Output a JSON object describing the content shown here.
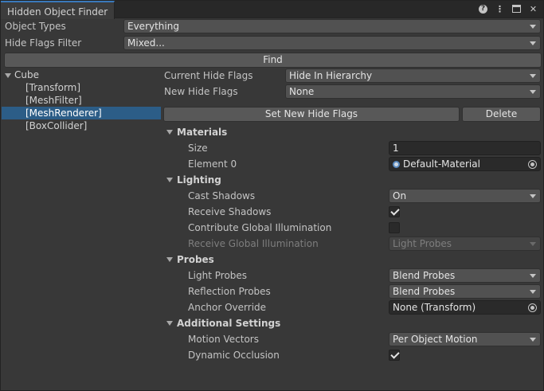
{
  "window": {
    "tab_title": "Hidden Object Finder"
  },
  "titlebar_icons": [
    "help-icon",
    "kebab-menu-icon",
    "maximize-icon",
    "close-icon"
  ],
  "filters": {
    "object_types_label": "Object Types",
    "object_types_value": "Everything",
    "hide_flags_filter_label": "Hide Flags Filter",
    "hide_flags_filter_value": "Mixed...",
    "find_label": "Find"
  },
  "tree": {
    "root": "Cube",
    "children": [
      "[Transform]",
      "[MeshFilter]",
      "[MeshRenderer]",
      "[BoxCollider]"
    ],
    "selected_index": 2
  },
  "flags": {
    "current_label": "Current Hide Flags",
    "current_value": "Hide In Hierarchy",
    "new_label": "New Hide Flags",
    "new_value": "None",
    "set_button": "Set New Hide Flags",
    "delete_button": "Delete"
  },
  "inspector": {
    "materials": {
      "header": "Materials",
      "size_label": "Size",
      "size_value": "1",
      "element0_label": "Element 0",
      "element0_value": "Default-Material"
    },
    "lighting": {
      "header": "Lighting",
      "cast_shadows_label": "Cast Shadows",
      "cast_shadows_value": "On",
      "receive_shadows_label": "Receive Shadows",
      "receive_shadows_checked": true,
      "contribute_gi_label": "Contribute Global Illumination",
      "contribute_gi_checked": false,
      "receive_gi_label": "Receive Global Illumination",
      "receive_gi_value": "Light Probes"
    },
    "probes": {
      "header": "Probes",
      "light_probes_label": "Light Probes",
      "light_probes_value": "Blend Probes",
      "reflection_probes_label": "Reflection Probes",
      "reflection_probes_value": "Blend Probes",
      "anchor_override_label": "Anchor Override",
      "anchor_override_value": "None (Transform)"
    },
    "additional": {
      "header": "Additional Settings",
      "motion_vectors_label": "Motion Vectors",
      "motion_vectors_value": "Per Object Motion",
      "dynamic_occlusion_label": "Dynamic Occlusion",
      "dynamic_occlusion_checked": true
    }
  },
  "colors": {
    "background": "#383838",
    "selection": "#2c5d87",
    "tab_accent": "#3a79bb"
  }
}
